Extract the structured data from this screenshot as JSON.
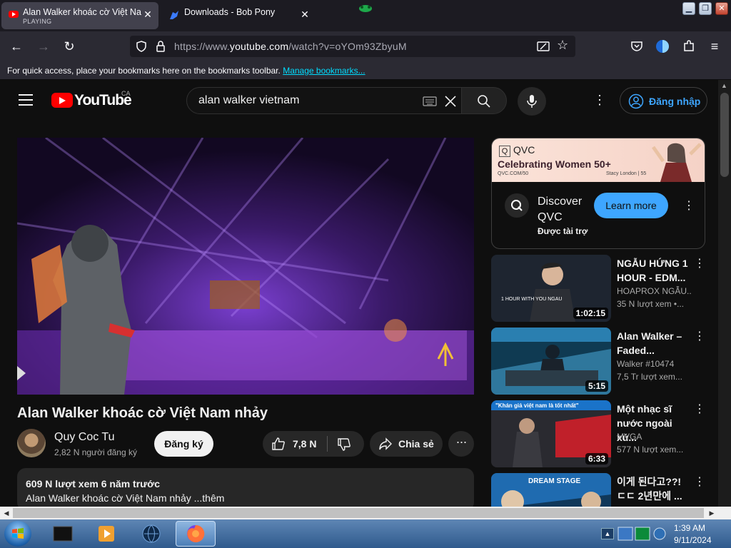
{
  "browser": {
    "tabs": [
      {
        "title": "Alan Walker khoác cờ Việt Nam",
        "status": "PLAYING",
        "active": true
      },
      {
        "title": "Downloads - Bob Pony",
        "active": false
      }
    ],
    "url": {
      "prefix": "https://www.",
      "domain": "youtube.com",
      "path": "/watch?v=oYOm93ZbyuM"
    },
    "bookmarks_hint": "For quick access, place your bookmarks here on the bookmarks toolbar.",
    "bookmarks_link": "Manage bookmarks..."
  },
  "youtube": {
    "logo_text": "YouTube",
    "country_code": "CA",
    "search_value": "alan walker vietnam",
    "signin_label": "Đăng nhập",
    "video": {
      "title": "Alan Walker khoác cờ Việt Nam nhảy",
      "channel": "Quy Coc Tu",
      "subscribers": "2,82 N người đăng ký",
      "subscribe_label": "Đăng ký",
      "likes": "7,8 N",
      "share_label": "Chia sẻ",
      "views_date": "609 N lượt xem  6 năm trước",
      "description": "Alan Walker khoác cờ Việt Nam nhảy ...thêm"
    },
    "ad": {
      "brand": "QVC",
      "headline": "Celebrating Women 50+",
      "small_left": "QVC.COM/50",
      "small_right": "Stacy London | 55",
      "title": "Discover QVC",
      "sponsored": "Được tài trợ",
      "cta": "Learn more"
    },
    "recommendations": [
      {
        "title": "NGẪU HỨNG 1 HOUR - EDM...",
        "channel": "HOAPROX NGẪU...",
        "views": "35 N lượt xem  •...",
        "duration": "1:02:15",
        "thumb_text": "1 HOUR WITH YOU NGAU"
      },
      {
        "title": "Alan Walker – Faded...",
        "channel": "Walker #10474",
        "views": "7,5 Tr lượt xem...",
        "duration": "5:15"
      },
      {
        "title": "Một nhạc sĩ nước ngoài xú...",
        "channel": "MVGA",
        "views": "577 N lượt xem...",
        "duration": "6:33",
        "thumb_text": "\"Khán giả việt nam là tốt nhất\""
      },
      {
        "title": "이게 된다고??! ㄷㄷ 2년만에 ...",
        "channel": "",
        "views": "",
        "duration": "",
        "thumb_text": "DREAM STAGE"
      }
    ]
  },
  "taskbar": {
    "time": "1:39 AM",
    "date": "9/11/2024"
  },
  "colors": {
    "yt_red": "#ff0000",
    "accent_blue": "#3ea6ff",
    "bg_dark": "#0f0f0f"
  }
}
